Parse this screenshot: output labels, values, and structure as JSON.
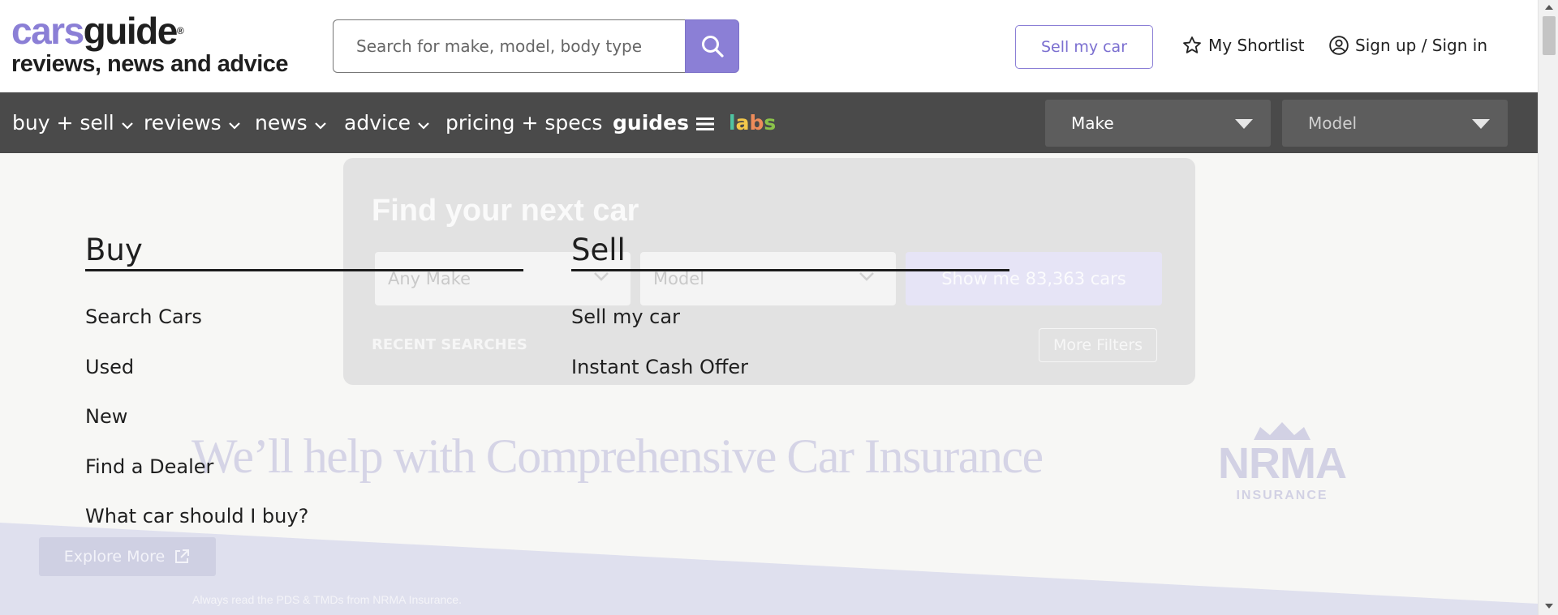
{
  "logo": {
    "word_a": "cars",
    "word_b": "guide",
    "reg": "®",
    "tagline": "reviews, news and advice"
  },
  "search": {
    "placeholder": "Search for make, model, body type",
    "button_icon": "search-icon"
  },
  "header": {
    "sell_label": "Sell my car",
    "shortlist_label": "My Shortlist",
    "shortlist_icon": "star-outline-icon",
    "signin_label": "Sign up / Sign in",
    "signin_icon": "user-circle-icon"
  },
  "nav": {
    "items": [
      {
        "label": "buy + sell",
        "has_chevron": true
      },
      {
        "label": "reviews",
        "has_chevron": true
      },
      {
        "label": "news",
        "has_chevron": true
      },
      {
        "label": "advice",
        "has_chevron": true
      },
      {
        "label": "pricing + specs",
        "has_chevron": false
      },
      {
        "label": "guides",
        "icon": "hamburger-icon"
      }
    ],
    "labs": [
      "l",
      "a",
      "b",
      "s"
    ],
    "make_select": "Make",
    "model_select": "Model"
  },
  "finder": {
    "title": "Find your next car",
    "make_placeholder": "Any Make",
    "model_placeholder": "Model",
    "show_button": "Show me 83,363 cars",
    "recent_label": "RECENT SEARCHES",
    "more_filters": "More Filters"
  },
  "ad": {
    "headline": "We’ll help with Comprehensive Car Insurance",
    "brand": "NRMA",
    "brand_sub": "INSURANCE",
    "explore_label": "Explore More",
    "disclaimer": "Always read the PDS & TMDs from NRMA Insurance."
  },
  "menu": {
    "buy": {
      "heading": "Buy",
      "links": [
        "Search Cars",
        "Used",
        "New",
        "Find a Dealer",
        "What car should I buy?"
      ]
    },
    "sell": {
      "heading": "Sell",
      "links": [
        "Sell my car",
        "Instant Cash Offer"
      ]
    }
  },
  "colors": {
    "brand_purple": "#8b7fd6",
    "nav_bg": "#4a4a4a",
    "page_bg": "#f7f7f5"
  }
}
